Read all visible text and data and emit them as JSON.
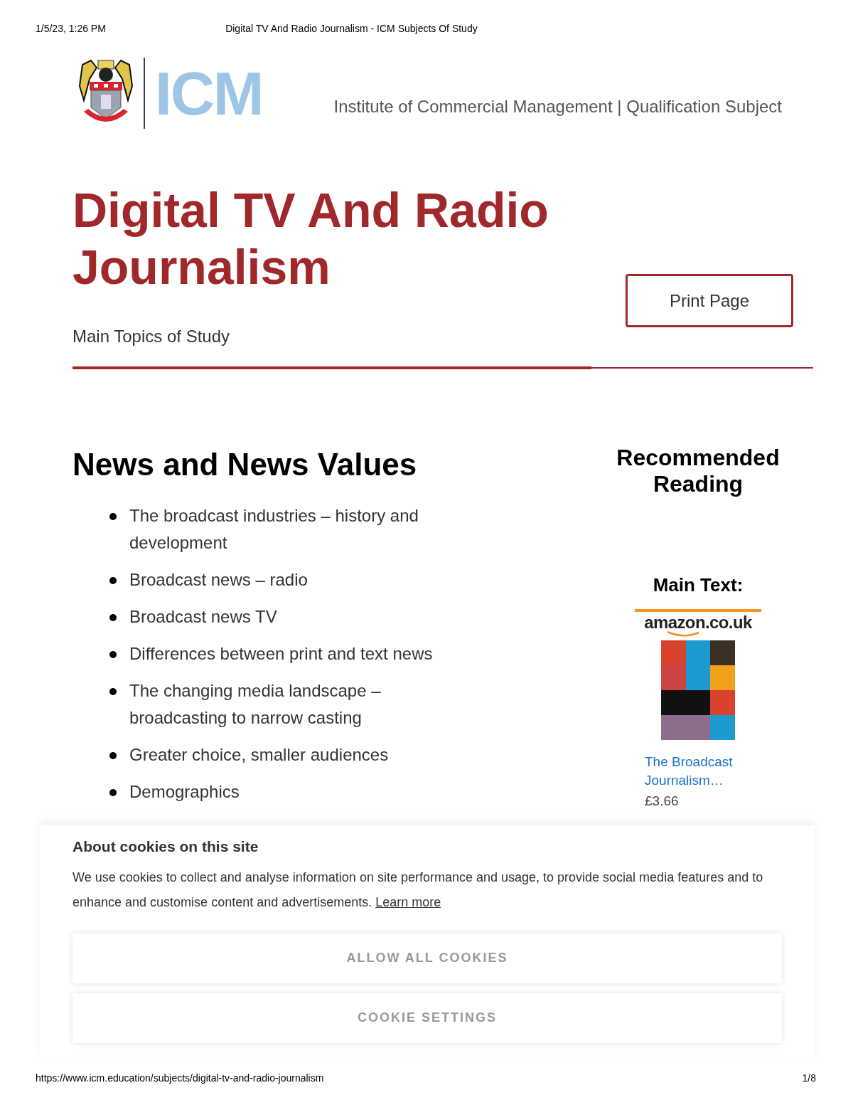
{
  "print_header": {
    "date": "1/5/23, 1:26 PM",
    "title": "Digital TV And Radio Journalism - ICM Subjects Of Study"
  },
  "header": {
    "logo_text": "ICM",
    "tagline": "Institute of Commercial Management | Qualification Subject"
  },
  "page": {
    "title": "Digital TV And Radio Journalism",
    "subtitle": "Main Topics of Study",
    "print_button": "Print Page"
  },
  "section": {
    "heading": "News and News Values",
    "items": [
      "The broadcast industries – history and development",
      "Broadcast news – radio",
      "Broadcast news TV",
      "Differences between print and text news",
      "The changing media landscape – broadcasting to narrow casting",
      "Greater choice, smaller audiences",
      "Demographics"
    ]
  },
  "sidebar": {
    "heading": "Recommended Reading",
    "main_text_label": "Main Text:",
    "store_logo": "amazon.co.uk",
    "book_title": "The Broadcast Journalism…",
    "price": "£3.66"
  },
  "cookie_banner": {
    "title": "About cookies on this site",
    "body": "We use cookies to collect and analyse information on site performance and usage, to provide social media features and to enhance and customise content and advertisements.",
    "link": "Learn more",
    "buttons": [
      "ALLOW ALL COOKIES",
      "COOKIE SETTINGS"
    ]
  },
  "print_footer": {
    "url": "https://www.icm.education/subjects/digital-tv-and-radio-journalism",
    "page": "1/8"
  }
}
